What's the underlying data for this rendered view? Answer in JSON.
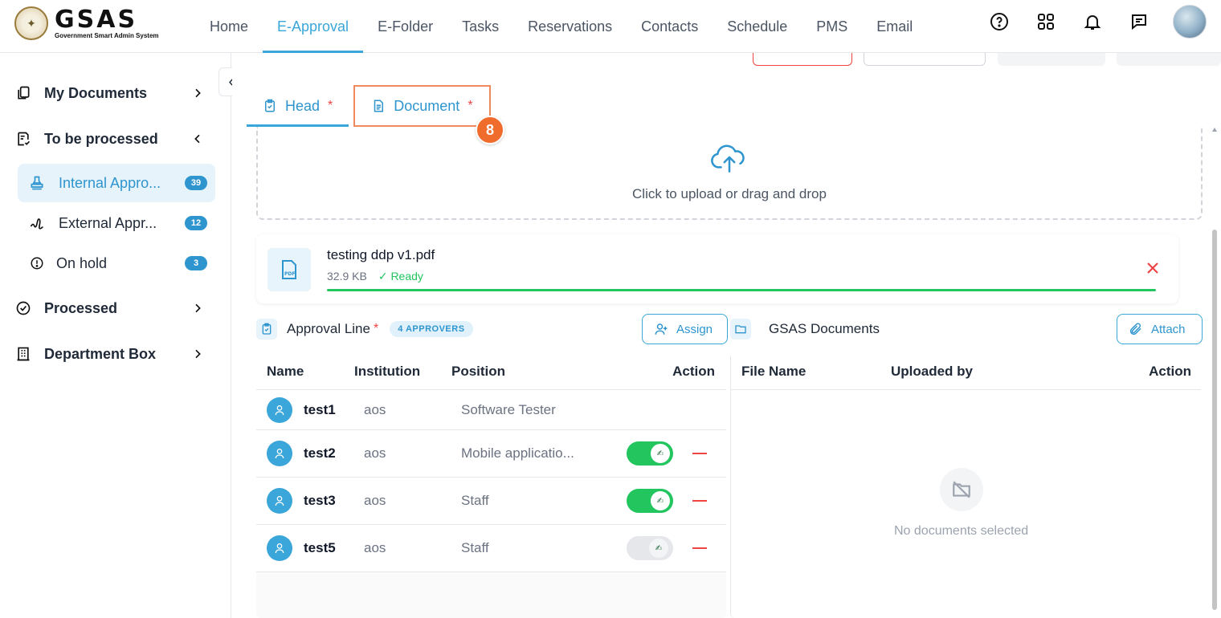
{
  "brand": {
    "name": "GSAS",
    "subtitle": "Government Smart Admin System"
  },
  "nav": {
    "items": [
      "Home",
      "E-Approval",
      "E-Folder",
      "Tasks",
      "Reservations",
      "Contacts",
      "Schedule",
      "PMS",
      "Email"
    ],
    "active": "E-Approval",
    "icons": [
      "help-icon",
      "apps-grid-icon",
      "bell-icon",
      "chat-icon"
    ]
  },
  "sidebar": {
    "sections": [
      {
        "label": "My Documents",
        "icon": "documents-icon"
      },
      {
        "label": "To be processed",
        "icon": "checklist-icon"
      },
      {
        "label": "Processed",
        "icon": "check-circle-icon"
      },
      {
        "label": "Department Box",
        "icon": "building-icon"
      }
    ],
    "sub_items": [
      {
        "label": "Internal Appro...",
        "count": "39",
        "icon": "stamp-icon"
      },
      {
        "label": "External Appr...",
        "count": "12",
        "icon": "signature-icon"
      },
      {
        "label": "On hold",
        "count": "3",
        "icon": "alert-circle-icon"
      }
    ]
  },
  "tabs": {
    "head": {
      "label": "Head",
      "required": "*"
    },
    "document": {
      "label": "Document",
      "required": "*"
    },
    "step": "8"
  },
  "upload": {
    "text": "Click to upload or drag and drop"
  },
  "file": {
    "name": "testing ddp v1.pdf",
    "size": "32.9 KB",
    "status": "✓ Ready",
    "progress": 1.0
  },
  "approval": {
    "title": "Approval Line",
    "required": "*",
    "count_pill": "4 APPROVERS",
    "assign_label": "Assign",
    "columns": [
      "Name",
      "Institution",
      "Position",
      "Action"
    ],
    "rows": [
      {
        "name": "test1",
        "institution": "aos",
        "position": "Software Tester"
      },
      {
        "name": "test2",
        "institution": "aos",
        "position": "Mobile applicatio..."
      },
      {
        "name": "test3",
        "institution": "aos",
        "position": "Staff"
      },
      {
        "name": "test5",
        "institution": "aos",
        "position": "Staff"
      }
    ]
  },
  "gsas_docs": {
    "title": "GSAS Documents",
    "attach_label": "Attach",
    "columns": [
      "File Name",
      "Uploaded by",
      "Action"
    ],
    "empty_text": "No documents selected"
  },
  "colors": {
    "accent": "#3aa6d9",
    "success": "#22c55e",
    "danger": "#ef4444",
    "step_badge": "#ef6c2d"
  }
}
